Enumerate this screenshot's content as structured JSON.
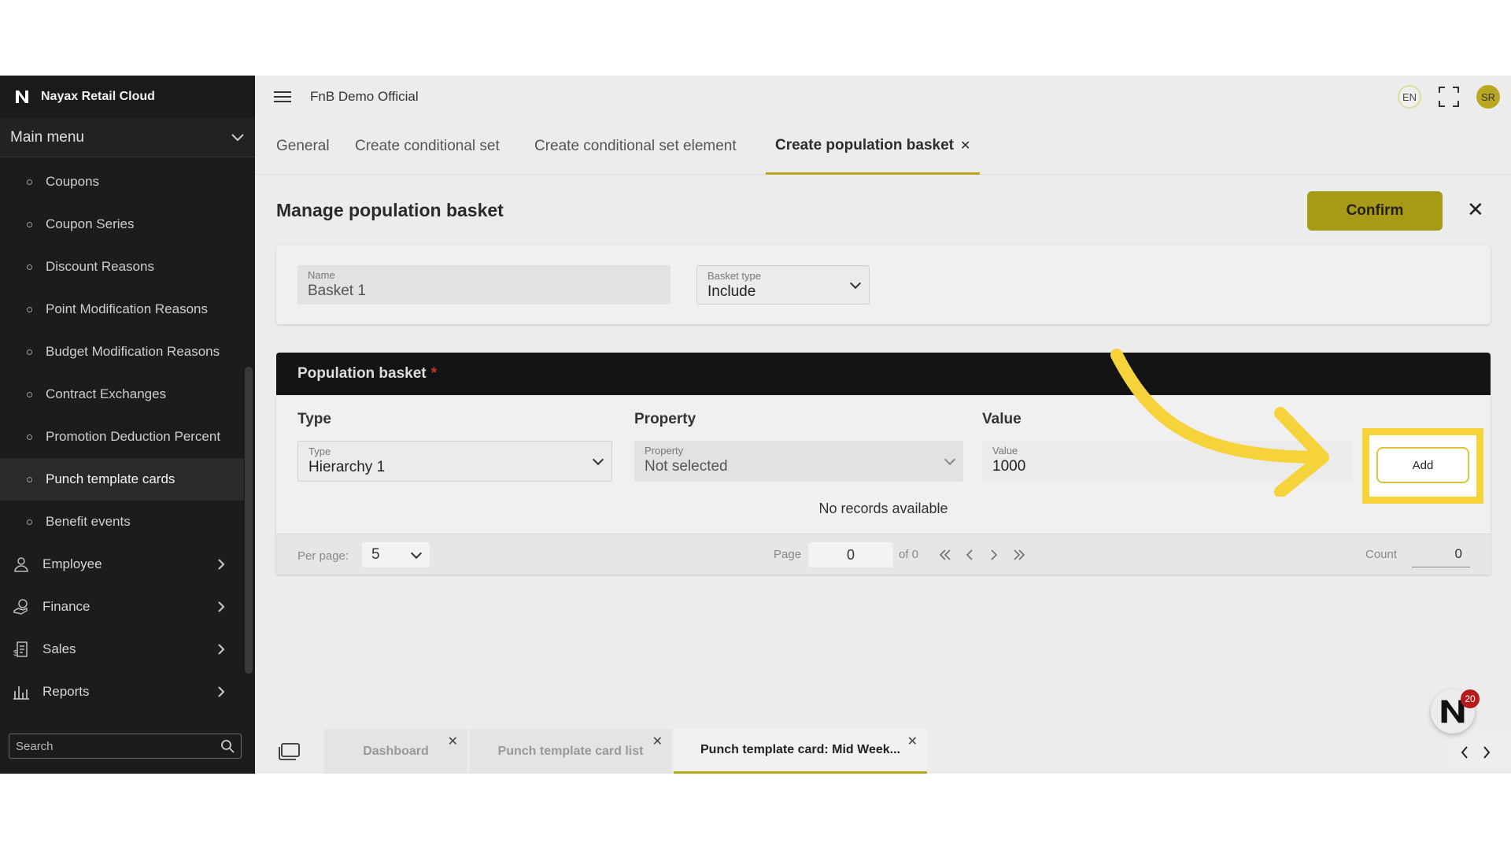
{
  "brand": {
    "name": "Nayax Retail Cloud"
  },
  "sidebar": {
    "main_menu": "Main menu",
    "sub_items": [
      {
        "label": "Coupons",
        "active": false
      },
      {
        "label": "Coupon Series",
        "active": false
      },
      {
        "label": "Discount Reasons",
        "active": false
      },
      {
        "label": "Point Modification Reasons",
        "active": false
      },
      {
        "label": "Budget Modification Reasons",
        "active": false
      },
      {
        "label": "Contract Exchanges",
        "active": false
      },
      {
        "label": "Promotion Deduction Percent",
        "active": false
      },
      {
        "label": "Punch template cards",
        "active": true
      },
      {
        "label": "Benefit events",
        "active": false
      }
    ],
    "groups": [
      {
        "label": "Employee",
        "icon": "employee-icon"
      },
      {
        "label": "Finance",
        "icon": "finance-icon"
      },
      {
        "label": "Sales",
        "icon": "sales-icon"
      },
      {
        "label": "Reports",
        "icon": "reports-icon"
      }
    ],
    "search_placeholder": "Search"
  },
  "topbar": {
    "org_name": "FnB Demo Official",
    "language": "EN",
    "user_initials": "SR"
  },
  "tabs": [
    {
      "label": "General"
    },
    {
      "label": "Create conditional set"
    },
    {
      "label": "Create conditional set element"
    },
    {
      "label": "Create population basket",
      "active": true
    }
  ],
  "page": {
    "title": "Manage population basket",
    "confirm_label": "Confirm"
  },
  "form": {
    "name_label": "Name",
    "name_value": "Basket 1",
    "basket_type_label": "Basket type",
    "basket_type_value": "Include"
  },
  "population_basket": {
    "title": "Population basket",
    "required_mark": "*",
    "columns": [
      "Type",
      "Property",
      "Value"
    ],
    "type_label": "Type",
    "type_value": "Hierarchy 1",
    "property_label": "Property",
    "property_value": "Not selected",
    "value_label": "Value",
    "value_value": "1000",
    "add_label": "Add",
    "empty_text": "No records available",
    "pager": {
      "per_page_label": "Per page:",
      "per_page_value": "5",
      "page_label": "Page",
      "page_value": "0",
      "of_label": "of 0",
      "count_label": "Count",
      "count_value": "0"
    }
  },
  "bottom_tabs": [
    {
      "label": "Dashboard"
    },
    {
      "label": "Punch template card list"
    },
    {
      "label": "Punch template card: Mid Week...",
      "active": true
    }
  ],
  "notification_count": "20",
  "colors": {
    "accent": "#b9a81c",
    "highlight": "#f6d33a",
    "sidebar": "#1c1c1c"
  }
}
